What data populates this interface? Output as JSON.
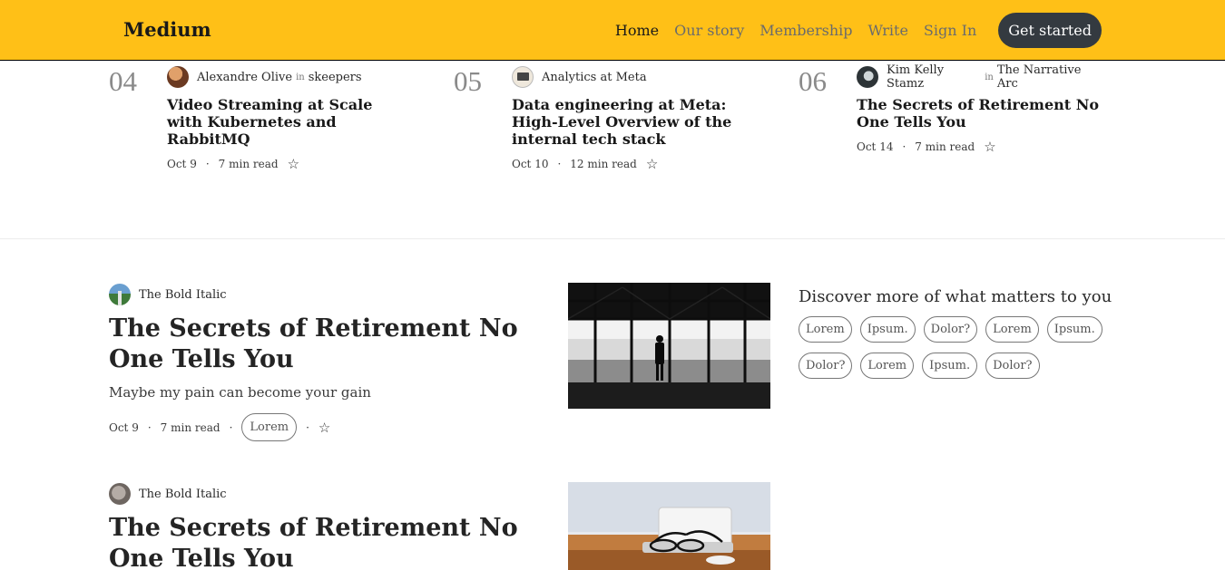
{
  "header": {
    "logo": "Medium",
    "nav": [
      "Home",
      "Our story",
      "Membership",
      "Write",
      "Sign In"
    ],
    "cta": "Get started"
  },
  "trending": [
    {
      "num": "04",
      "author": "Alexandre Olive",
      "in": "in",
      "publication": "skeepers",
      "title": "Video Streaming at Scale with Kubernetes and RabbitMQ",
      "date": "Oct 9",
      "read": "7 min read"
    },
    {
      "num": "05",
      "author": "Analytics at Meta",
      "in": "",
      "publication": "",
      "title": "Data engineering at Meta: High-Level Overview of the internal tech stack",
      "date": "Oct 10",
      "read": "12 min read"
    },
    {
      "num": "06",
      "author": "Kim Kelly Stamz",
      "in": "in",
      "publication": "The Narrative Arc",
      "title": "The Secrets of Retirement No One Tells You",
      "date": "Oct 14",
      "read": "7 min read"
    }
  ],
  "feed": [
    {
      "author": "The Bold Italic",
      "title": "The Secrets of Retirement No One Tells You",
      "subtitle": "Maybe my pain can become your gain",
      "date": "Oct 9",
      "read": "7 min read",
      "tag": "Lorem",
      "dot": "·"
    },
    {
      "author": "The Bold Italic",
      "title": "The Secrets of Retirement No One Tells You"
    }
  ],
  "discover": {
    "title": "Discover more of what matters to you",
    "tags": [
      "Lorem",
      "Ipsum.",
      "Dolor?",
      "Lorem",
      "Ipsum.",
      "Dolor?",
      "Lorem",
      "Ipsum.",
      "Dolor?"
    ]
  },
  "separator": "·",
  "icons": {
    "bookmark": "star-icon"
  },
  "colors": {
    "header_bg": "#ffc017",
    "cta_bg": "#343a40"
  }
}
